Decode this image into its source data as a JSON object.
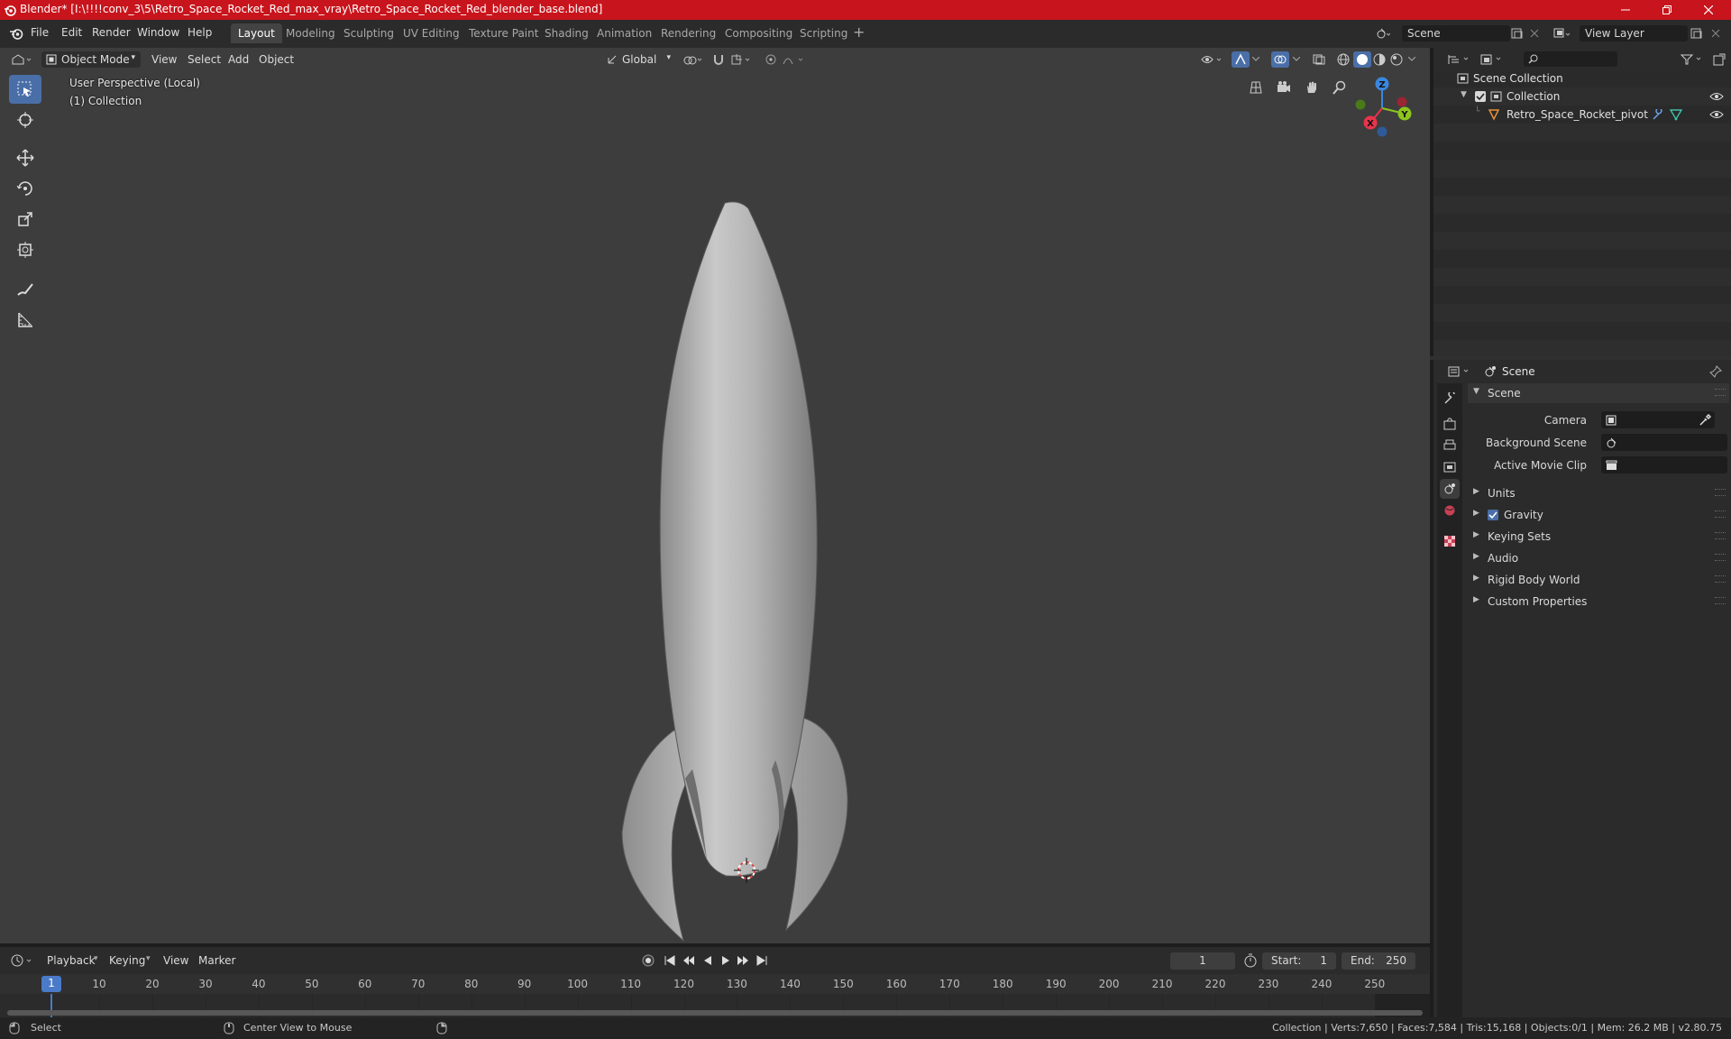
{
  "window": {
    "title": "Blender* [I:\\!!!!conv_3\\5\\Retro_Space_Rocket_Red_max_vray\\Retro_Space_Rocket_Red_blender_base.blend]"
  },
  "menu": [
    "File",
    "Edit",
    "Render",
    "Window",
    "Help"
  ],
  "workspaces": [
    "Layout",
    "Modeling",
    "Sculpting",
    "UV Editing",
    "Texture Paint",
    "Shading",
    "Animation",
    "Rendering",
    "Compositing",
    "Scripting"
  ],
  "active_workspace": "Layout",
  "scene_field": "Scene",
  "view_layer_field": "View Layer",
  "viewport": {
    "mode": "Object Mode",
    "menus": [
      "View",
      "Select",
      "Add",
      "Object"
    ],
    "orientation": "Global",
    "overlay_line1": "User Perspective (Local)",
    "overlay_line2": "(1) Collection",
    "gizmo_axes": {
      "x": "X",
      "y": "Y",
      "z": "Z"
    },
    "colors": {
      "x": "#e8344a",
      "y": "#8cc51e",
      "z": "#3a87e0",
      "active_tool": "#4a6fa8"
    }
  },
  "outliner": {
    "search_placeholder": "",
    "root": "Scene Collection",
    "collection": "Collection",
    "object": "Retro_Space_Rocket_pivot"
  },
  "properties": {
    "context": "Scene",
    "panel_title": "Scene",
    "camera_label": "Camera",
    "background_scene_label": "Background Scene",
    "movie_clip_label": "Active Movie Clip",
    "sections": [
      "Units",
      "Gravity",
      "Keying Sets",
      "Audio",
      "Rigid Body World",
      "Custom Properties"
    ],
    "gravity_enabled": true
  },
  "timeline": {
    "menus": [
      "Playback",
      "Keying",
      "View",
      "Marker"
    ],
    "current_frame": "1",
    "start_label": "Start:",
    "start_value": "1",
    "end_label": "End:",
    "end_value": "250",
    "ticks": [
      "1",
      "10",
      "20",
      "30",
      "40",
      "50",
      "60",
      "70",
      "80",
      "90",
      "100",
      "110",
      "120",
      "130",
      "140",
      "150",
      "160",
      "170",
      "180",
      "190",
      "200",
      "210",
      "220",
      "230",
      "240",
      "250"
    ]
  },
  "status": {
    "left_action": "Select",
    "middle_action": "Center View to Mouse",
    "stats": "Collection | Verts:7,650 | Faces:7,584 | Tris:15,168 | Objects:0/1 | Mem: 26.2 MB | v2.80.75"
  }
}
